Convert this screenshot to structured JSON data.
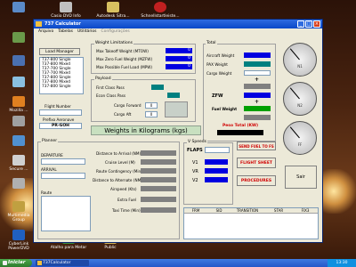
{
  "desktop": {
    "icons": [
      {
        "label": ""
      },
      {
        "label": "Casio DVD Info ..."
      },
      {
        "label": "Autodesk Sitra..."
      },
      {
        "label": "Schnellstartleiste..."
      },
      {
        "label": ""
      },
      {
        "label": ""
      },
      {
        "label": ""
      },
      {
        "label": "Mozilla ..."
      },
      {
        "label": ""
      },
      {
        "label": ""
      },
      {
        "label": "Secure ..."
      },
      {
        "label": ""
      },
      {
        "label": "Multimedia Group"
      },
      {
        "label": "CyberLink PowerDVD"
      },
      {
        "label": "Atalho para Metar"
      },
      {
        "label": "Public"
      }
    ]
  },
  "window": {
    "title": "737 Calculator",
    "menu": [
      "Arquivo",
      "Tabelas",
      "Utilitários",
      "Configurações"
    ]
  },
  "aircraft": {
    "load_manager_btn": "Load Manager",
    "list": [
      "737-800 Single",
      "737-800 Mixed",
      "737-700 Single",
      "737-700 Mixed",
      "737-800 Single",
      "737-800 Mixed",
      "737-800 Single"
    ],
    "flight_number_label": "Flight Number",
    "prefix_label": "Prefixo Aeronave",
    "prefix_value": "PR-GOH"
  },
  "weight_limitations": {
    "title": "Weight Limitations",
    "mtow_label": "Max Takeoff Weight (MTOW)",
    "mtow_value": "0",
    "mzfw_label": "Max Zero Fuel Weight (MZFW)",
    "mzfw_value": "0",
    "mlw_label": "Max Possible Fuel Load (MPW)",
    "mlw_value": "0"
  },
  "payload": {
    "title": "Payload",
    "first_label": "First Class Pass",
    "econ_label": "Econ Class Pass",
    "cargo_fwd_label": "Cargo Forward",
    "cargo_aft_label": "Cargo Aft",
    "cargo_fwd_value": "0",
    "cargo_aft_value": "0"
  },
  "weights_banner": "Weights in Kilograms (kgs)",
  "total": {
    "title": "Total",
    "aircraft_weight_label": "Aircraft Weight",
    "pax_weight_label": "PAX Weight",
    "cargo_weight_label": "Cargo Weight",
    "zfw_label": "ZFW",
    "fuel_weight_label": "Fuel Weight",
    "peso_total_label": "Peso Total (KW)",
    "plus1": "+",
    "eq": "=",
    "plus2": "+",
    "eq2": "="
  },
  "gauges": [
    {
      "label": "N1"
    },
    {
      "label": "N2"
    },
    {
      "label": "FF"
    }
  ],
  "planner": {
    "title": "Planner",
    "departure_label": "DEPARTURE",
    "arrival_label": "ARRIVAL",
    "route_label": "Route",
    "distance_arrival_label": "Distance to Arrival (NM)",
    "cruise_level_label": "Cruise Level (M)",
    "route_contingency_label": "Route Contingency (Min)",
    "distance_alternate_label": "Distance to Alternate (NM)",
    "airspeed_label": "Airspeed (Kts)",
    "extra_fuel_label": "Extra Fuel",
    "taxi_time_label": "Taxi Time (Min)"
  },
  "vspeeds": {
    "title": "V Speeds",
    "flaps_label": "FLAPS",
    "v1_label": "V1",
    "vr_label": "VR",
    "v2_label": "V2",
    "send_fuel_btn": "SEND FUEL TO FS",
    "flight_sheet_btn": "FLIGHT SHEET",
    "procedures_btn": "PROCEDURES",
    "sair_btn": "Sair"
  },
  "route_table": {
    "columns": [
      "FRM",
      "SID",
      "TRANSITION",
      "STAR",
      "FIX3"
    ]
  },
  "taskbar": {
    "start_label": "Iniciar",
    "task_label": "737Calculator",
    "clock": "13:30"
  }
}
